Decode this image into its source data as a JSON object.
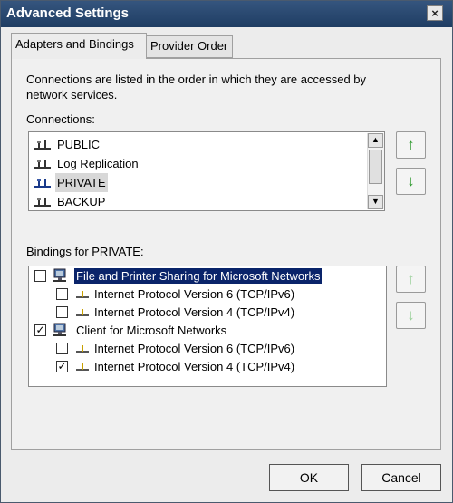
{
  "window": {
    "title": "Advanced Settings",
    "close_glyph": "×"
  },
  "tabs": [
    {
      "label": "Adapters and Bindings",
      "active": true
    },
    {
      "label": "Provider Order",
      "active": false
    }
  ],
  "description": {
    "line1": "Connections are listed in the order in which they are accessed by",
    "line2": "network services."
  },
  "connections": {
    "label": "Connections:",
    "items": [
      {
        "label": "PUBLIC",
        "icon": "network-adapter-icon"
      },
      {
        "label": "Log Replication",
        "icon": "network-adapter-icon"
      },
      {
        "label": "PRIVATE",
        "icon": "network-adapter-icon",
        "selected": true
      },
      {
        "label": "BACKUP",
        "icon": "network-adapter-icon"
      }
    ],
    "move_up": "↑",
    "move_down": "↓"
  },
  "bindings": {
    "label": "Bindings for PRIVATE:",
    "items": [
      {
        "label": "File and Printer Sharing for Microsoft Networks",
        "checked": false,
        "icon": "computer-network-icon"
      },
      {
        "label": "Internet Protocol Version 6 (TCP/IPv6)",
        "checked": false,
        "icon": "protocol-icon"
      },
      {
        "label": "Internet Protocol Version 4 (TCP/IPv4)",
        "checked": false,
        "icon": "protocol-icon"
      },
      {
        "label": "Client for Microsoft Networks",
        "checked": true,
        "icon": "computer-network-icon"
      },
      {
        "label": "Internet Protocol Version 6 (TCP/IPv6)",
        "checked": false,
        "icon": "protocol-icon"
      },
      {
        "label": "Internet Protocol Version 4 (TCP/IPv4)",
        "checked": true,
        "icon": "protocol-icon"
      }
    ],
    "move_up": "↑",
    "move_down": "↓"
  },
  "buttons": {
    "ok": "OK",
    "cancel": "Cancel"
  },
  "colors": {
    "titlebar": "#1f3d63",
    "highlight": "#0a246a",
    "arrow_green": "#2f9a2f"
  }
}
